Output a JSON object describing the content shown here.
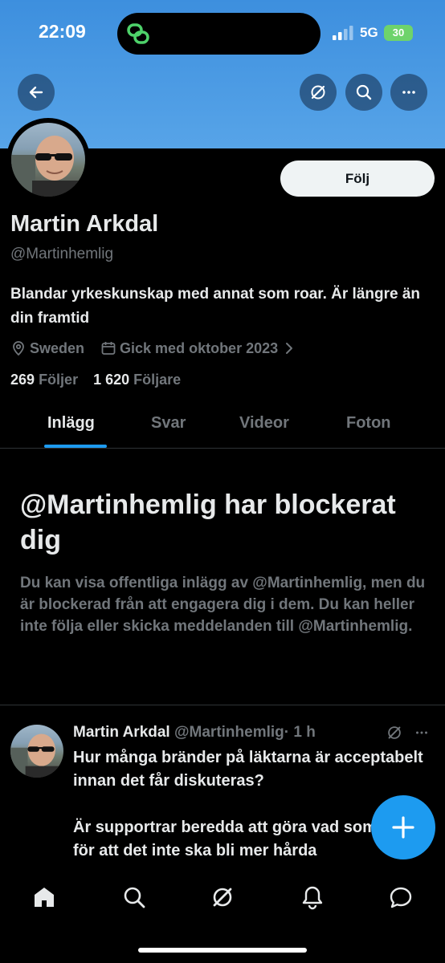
{
  "status_bar": {
    "time": "22:09",
    "network": "5G",
    "battery": "30"
  },
  "profile": {
    "follow_label": "Följ",
    "name": "Martin Arkdal",
    "handle": "@Martinhemlig",
    "bio": "Blandar yrkeskunskap med annat som roar. Är längre än din framtid",
    "location": "Sweden",
    "joined": "Gick med oktober 2023",
    "following_count": "269",
    "following_label": "Följer",
    "followers_count": "1 620",
    "followers_label": "Följare"
  },
  "tabs": [
    {
      "label": "Inlägg",
      "active": true
    },
    {
      "label": "Svar"
    },
    {
      "label": "Videor"
    },
    {
      "label": "Foton"
    }
  ],
  "blocked": {
    "title": "@Martinhemlig har blockerat dig",
    "description": "Du kan visa offentliga inlägg av @Martinhemlig, men du är blockerad från att engagera dig i dem. Du kan heller inte följa eller skicka meddelanden till @Martinhemlig."
  },
  "post": {
    "name": "Martin Arkdal",
    "handle": "@Martinhemlig",
    "time": "· 1 h",
    "text": "Hur många bränder på läktarna är acceptabelt innan det får diskuteras?\n\nÄr supportrar beredda att göra vad som krävs för att det inte ska bli mer hårda bestraffningar?"
  },
  "colors": {
    "accent": "#1d9bf0",
    "banner": "#4a9ae3",
    "background": "#000000",
    "secondary_text": "#71767b"
  },
  "icons": [
    "back-arrow-icon",
    "grok-icon",
    "search-icon",
    "more-icon",
    "location-pin-icon",
    "calendar-icon",
    "chevron-right-icon",
    "plus-icon",
    "home-icon",
    "explore-icon",
    "grok-nav-icon",
    "bell-icon",
    "messages-icon"
  ]
}
